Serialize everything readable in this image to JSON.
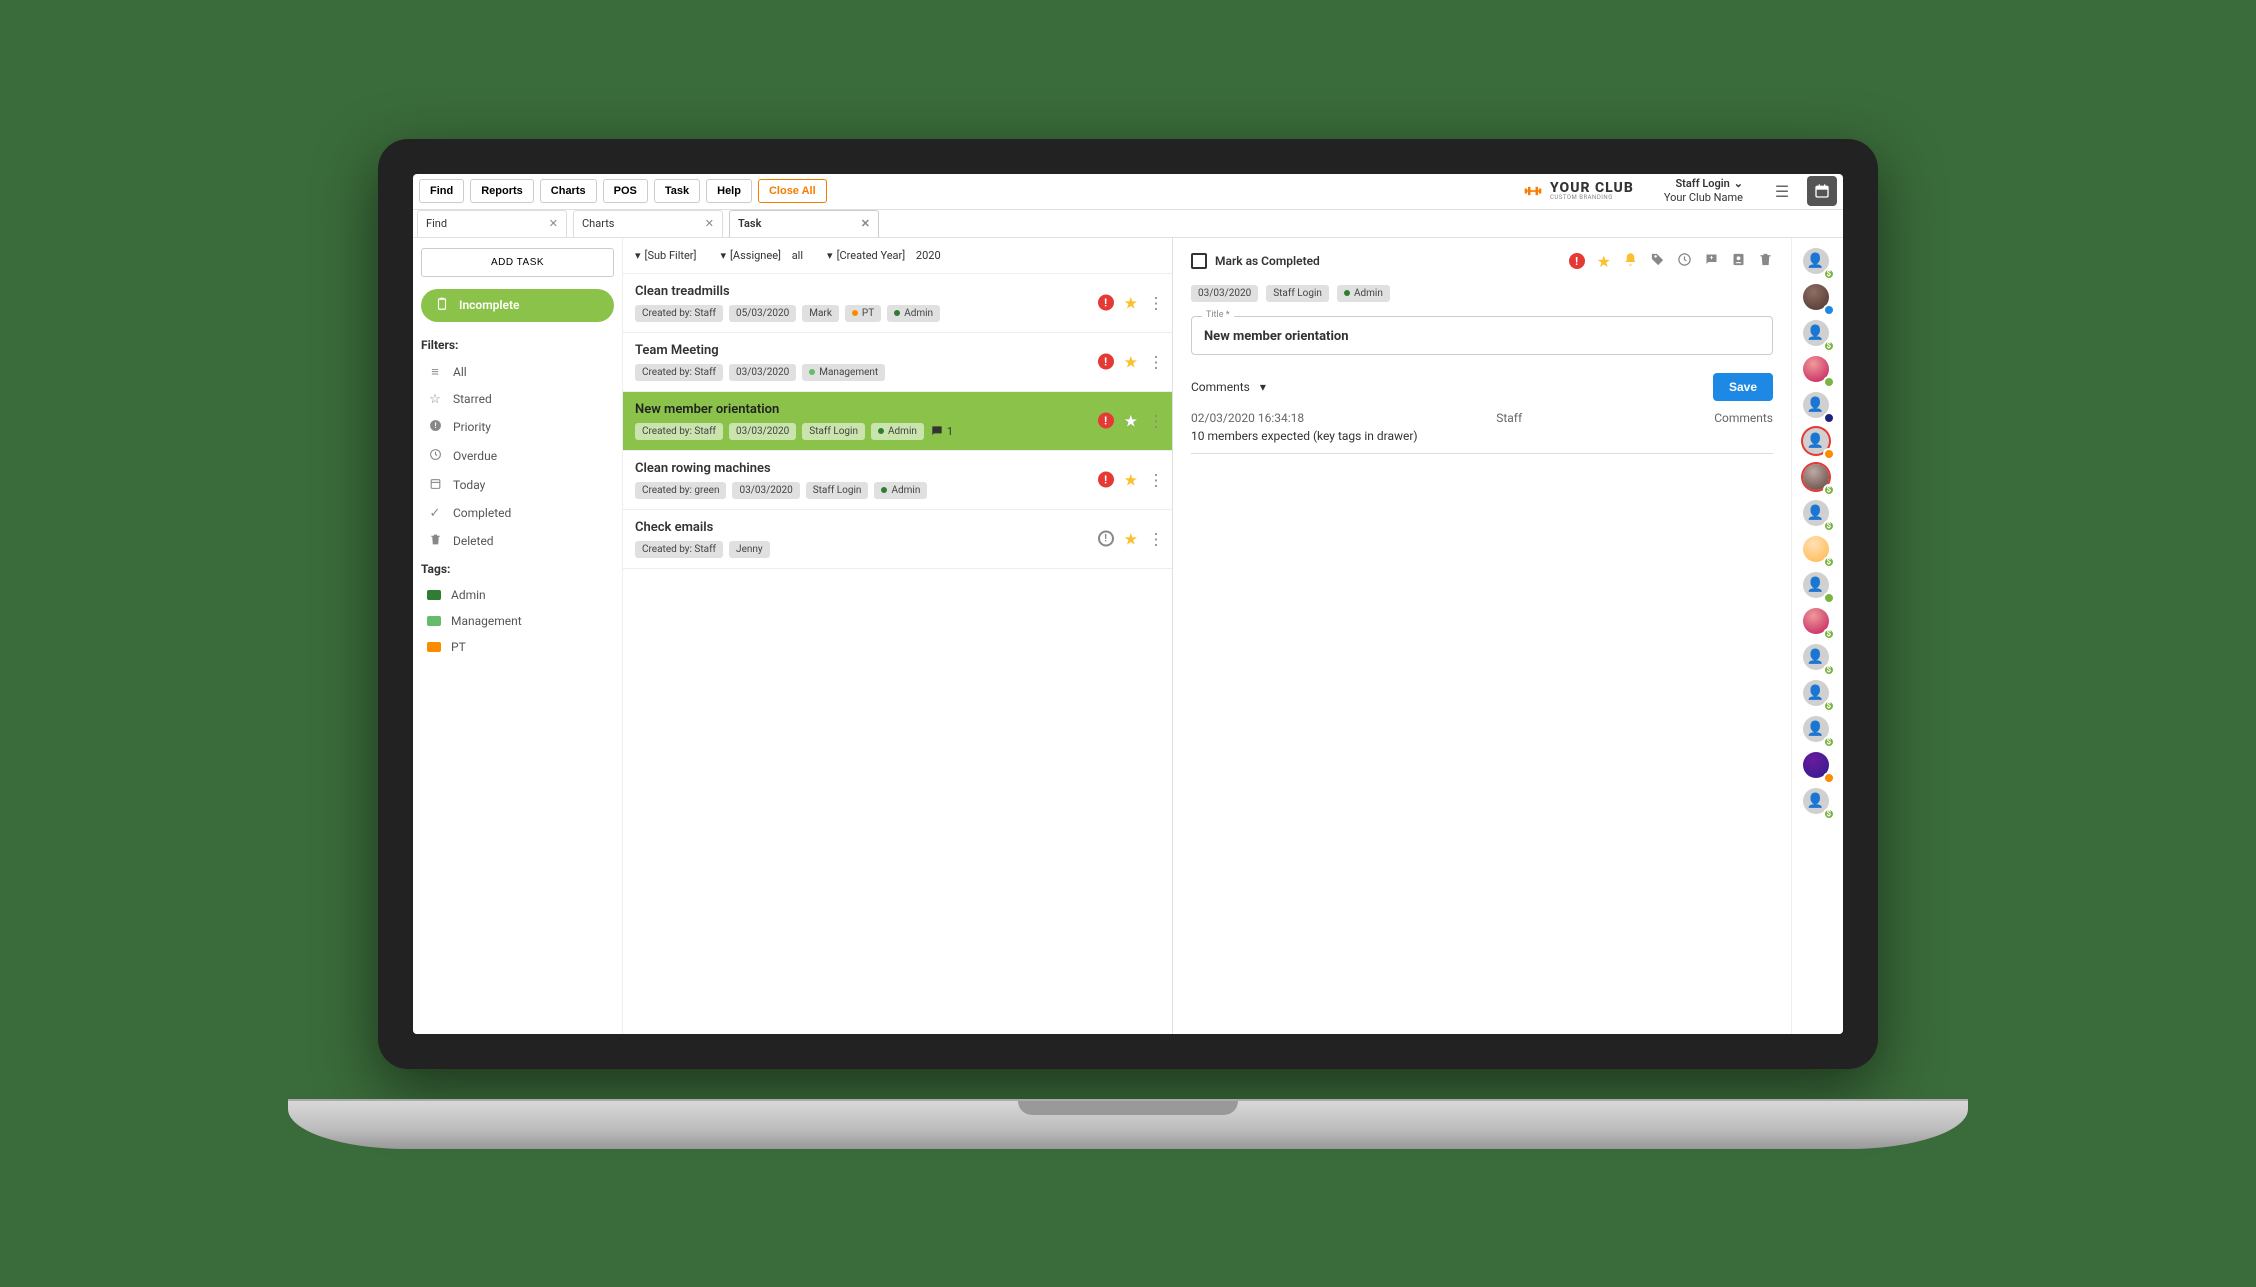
{
  "nav": {
    "items": [
      "Find",
      "Reports",
      "Charts",
      "POS",
      "Task",
      "Help"
    ],
    "close_all": "Close All"
  },
  "branding": {
    "name": "YOUR CLUB",
    "sub": "CUSTOM BRANDING"
  },
  "user": {
    "login": "Staff Login",
    "club": "Your Club Name"
  },
  "tabs": [
    {
      "label": "Find"
    },
    {
      "label": "Charts"
    },
    {
      "label": "Task",
      "active": true
    }
  ],
  "sidebar": {
    "add_task": "ADD TASK",
    "active": "Incomplete",
    "filters_heading": "Filters:",
    "filters": [
      {
        "icon": "≡",
        "label": "All"
      },
      {
        "icon": "☆",
        "label": "Starred"
      },
      {
        "icon": "!",
        "label": "Priority"
      },
      {
        "icon": "⏱",
        "label": "Overdue"
      },
      {
        "icon": "☐",
        "label": "Today"
      },
      {
        "icon": "✓",
        "label": "Completed"
      },
      {
        "icon": "🗑",
        "label": "Deleted"
      }
    ],
    "tags_heading": "Tags:",
    "tags": [
      {
        "color": "#2e7d32",
        "label": "Admin"
      },
      {
        "color": "#66bb6a",
        "label": "Management"
      },
      {
        "color": "#fb8c00",
        "label": "PT"
      }
    ]
  },
  "filterbar": {
    "sub_filter": "[Sub Filter]",
    "assignee_label": "[Assignee]",
    "assignee_value": "all",
    "year_label": "[Created Year]",
    "year_value": "2020"
  },
  "tasks": [
    {
      "title": "Clean treadmills",
      "created_by": "Created by: Staff",
      "date": "05/03/2020",
      "assignee": "Mark",
      "tags": [
        {
          "color": "#fb8c00",
          "label": "PT"
        },
        {
          "color": "#2e7d32",
          "label": "Admin"
        }
      ],
      "alert": "red",
      "star": "solid"
    },
    {
      "title": "Team Meeting",
      "created_by": "Created by: Staff",
      "date": "03/03/2020",
      "tags": [
        {
          "color": "#66bb6a",
          "label": "Management"
        }
      ],
      "alert": "red",
      "star": "solid"
    },
    {
      "title": "New member orientation",
      "created_by": "Created by: Staff",
      "date": "03/03/2020",
      "assignee": "Staff Login",
      "tags": [
        {
          "color": "#2e7d32",
          "label": "Admin"
        }
      ],
      "comments": "1",
      "alert": "red",
      "star": "hollow",
      "selected": true
    },
    {
      "title": "Clean rowing machines",
      "created_by": "Created by: green",
      "date": "03/03/2020",
      "assignee": "Staff Login",
      "tags": [
        {
          "color": "#2e7d32",
          "label": "Admin"
        }
      ],
      "alert": "red",
      "star": "solid"
    },
    {
      "title": "Check emails",
      "created_by": "Created by: Staff",
      "assignee": "Jenny",
      "alert": "outline",
      "star": "solid"
    }
  ],
  "detail": {
    "mark_complete": "Mark as Completed",
    "date": "03/03/2020",
    "assignee": "Staff Login",
    "tag": {
      "color": "#2e7d32",
      "label": "Admin"
    },
    "title_label": "Title *",
    "title_value": "New member orientation",
    "comments_label": "Comments",
    "save": "Save",
    "comment": {
      "timestamp": "02/03/2020 16:34:18",
      "author": "Staff",
      "col": "Comments",
      "body": "10 members expected (key tags in drawer)"
    }
  },
  "rail_caption": ""
}
